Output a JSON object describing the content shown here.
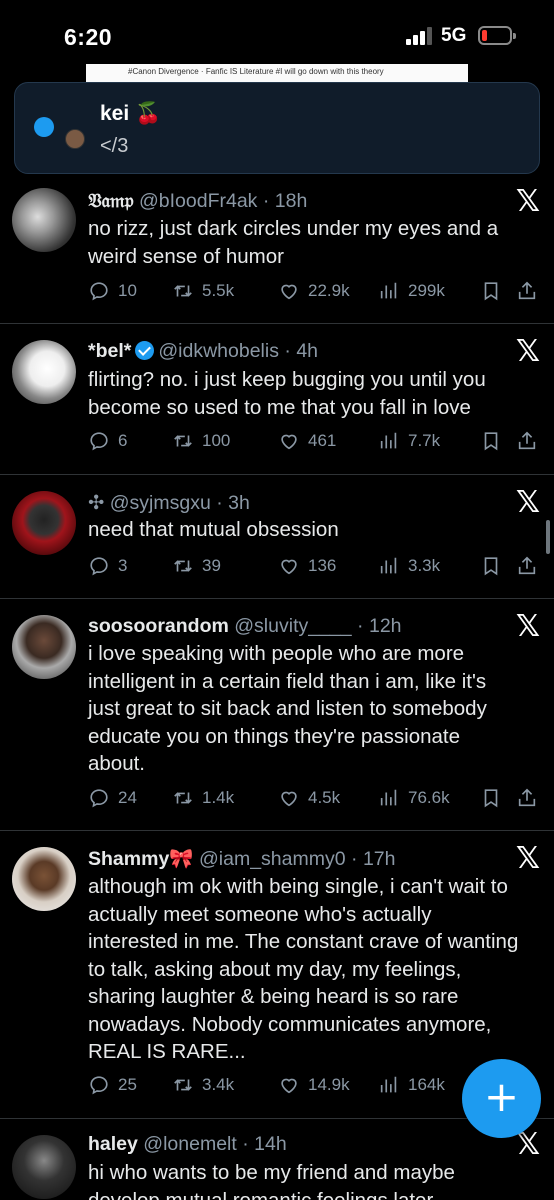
{
  "status_bar": {
    "time": "6:20",
    "network": "5G"
  },
  "background_strip": {
    "text": "#Canon Divergence · Fanfic IS Literature #I will go down with this theory"
  },
  "notification": {
    "name": "kei 🍒",
    "text": "</3"
  },
  "tweets": [
    {
      "display_name": "𝔙𝔞𝔪𝔭",
      "handle": "@bIoodFr4ak",
      "time": "18h",
      "verified": false,
      "lines": [
        "no rizz, just dark circles under my eyes and a",
        "weird sense of humor"
      ],
      "replies": "10",
      "reposts": "5.5k",
      "likes": "22.9k",
      "views": "299k"
    },
    {
      "display_name": "*bel*",
      "handle": "@idkwhobelis",
      "time": "4h",
      "verified": true,
      "lines": [
        "flirting? no. i just keep bugging you until you",
        "become so used to me that you fall in love"
      ],
      "replies": "6",
      "reposts": "100",
      "likes": "461",
      "views": "7.7k"
    },
    {
      "display_name": "✣",
      "handle": "@syjmsgxu",
      "time": "3h",
      "verified": false,
      "lines": [
        "need that mutual obsession"
      ],
      "replies": "3",
      "reposts": "39",
      "likes": "136",
      "views": "3.3k"
    },
    {
      "display_name": "soosoorandom",
      "handle": "@sluvity____",
      "time": "12h",
      "verified": false,
      "lines": [
        "i love speaking with people who are more",
        "intelligent in a certain field than i am, like it's",
        "just great to sit back and listen to somebody",
        "educate you on things they're passionate",
        "about."
      ],
      "replies": "24",
      "reposts": "1.4k",
      "likes": "4.5k",
      "views": "76.6k"
    },
    {
      "display_name": "Shammy🎀",
      "handle": "@iam_shammy0",
      "time": "17h",
      "verified": false,
      "lines": [
        "although im ok with being single, i can't wait to",
        "actually meet someone who's actually",
        "interested in me. The constant crave of wanting",
        "to talk, asking about my day, my feelings,",
        "sharing laughter & being heard is so rare",
        "nowadays. Nobody communicates anymore,",
        "REAL IS RARE..."
      ],
      "replies": "25",
      "reposts": "3.4k",
      "likes": "14.9k",
      "views": "164k"
    },
    {
      "display_name": "haley",
      "handle": "@lonemelt",
      "time": "14h",
      "verified": false,
      "lines": [
        "hi who wants to be my friend and maybe",
        "develop mutual romantic feelings later"
      ],
      "replies": "",
      "reposts": "",
      "likes": "",
      "views": ""
    }
  ],
  "compose_button": {
    "label": "+"
  },
  "colors": {
    "accent": "#1d9bf0",
    "background": "#000000",
    "muted": "#8b98a5",
    "divider": "#2f3336"
  }
}
